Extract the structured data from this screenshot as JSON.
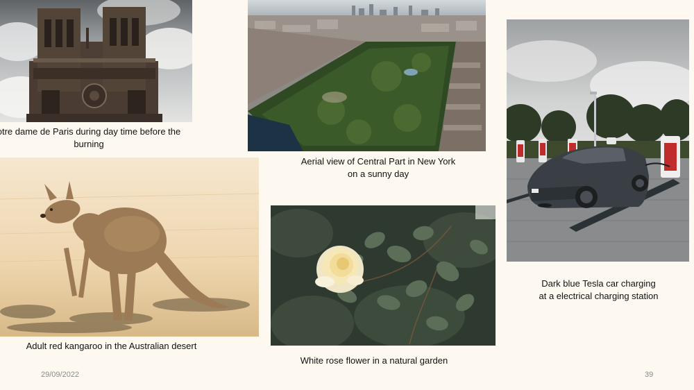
{
  "slide": {
    "photos": [
      {
        "id": "notre-dame",
        "caption": "otre dame de Paris during day time before the burning",
        "icon": "cathedral-photo"
      },
      {
        "id": "central-park",
        "caption": "Aerial view of Central Part in New York on a sunny day",
        "icon": "city-park-photo"
      },
      {
        "id": "tesla",
        "caption": "Dark blue Tesla car charging at a electrical charging station",
        "icon": "car-charging-photo"
      },
      {
        "id": "kangaroo",
        "caption": "Adult red kangaroo in the Australian desert",
        "icon": "kangaroo-photo"
      },
      {
        "id": "rose",
        "caption": "White rose flower in a natural garden",
        "icon": "rose-photo"
      }
    ],
    "footer": {
      "date": "29/09/2022",
      "page_number": "39"
    }
  },
  "colors": {
    "background": "#fdf9f0",
    "caption_text": "#111111",
    "footer_text": "#8a8a8a"
  }
}
